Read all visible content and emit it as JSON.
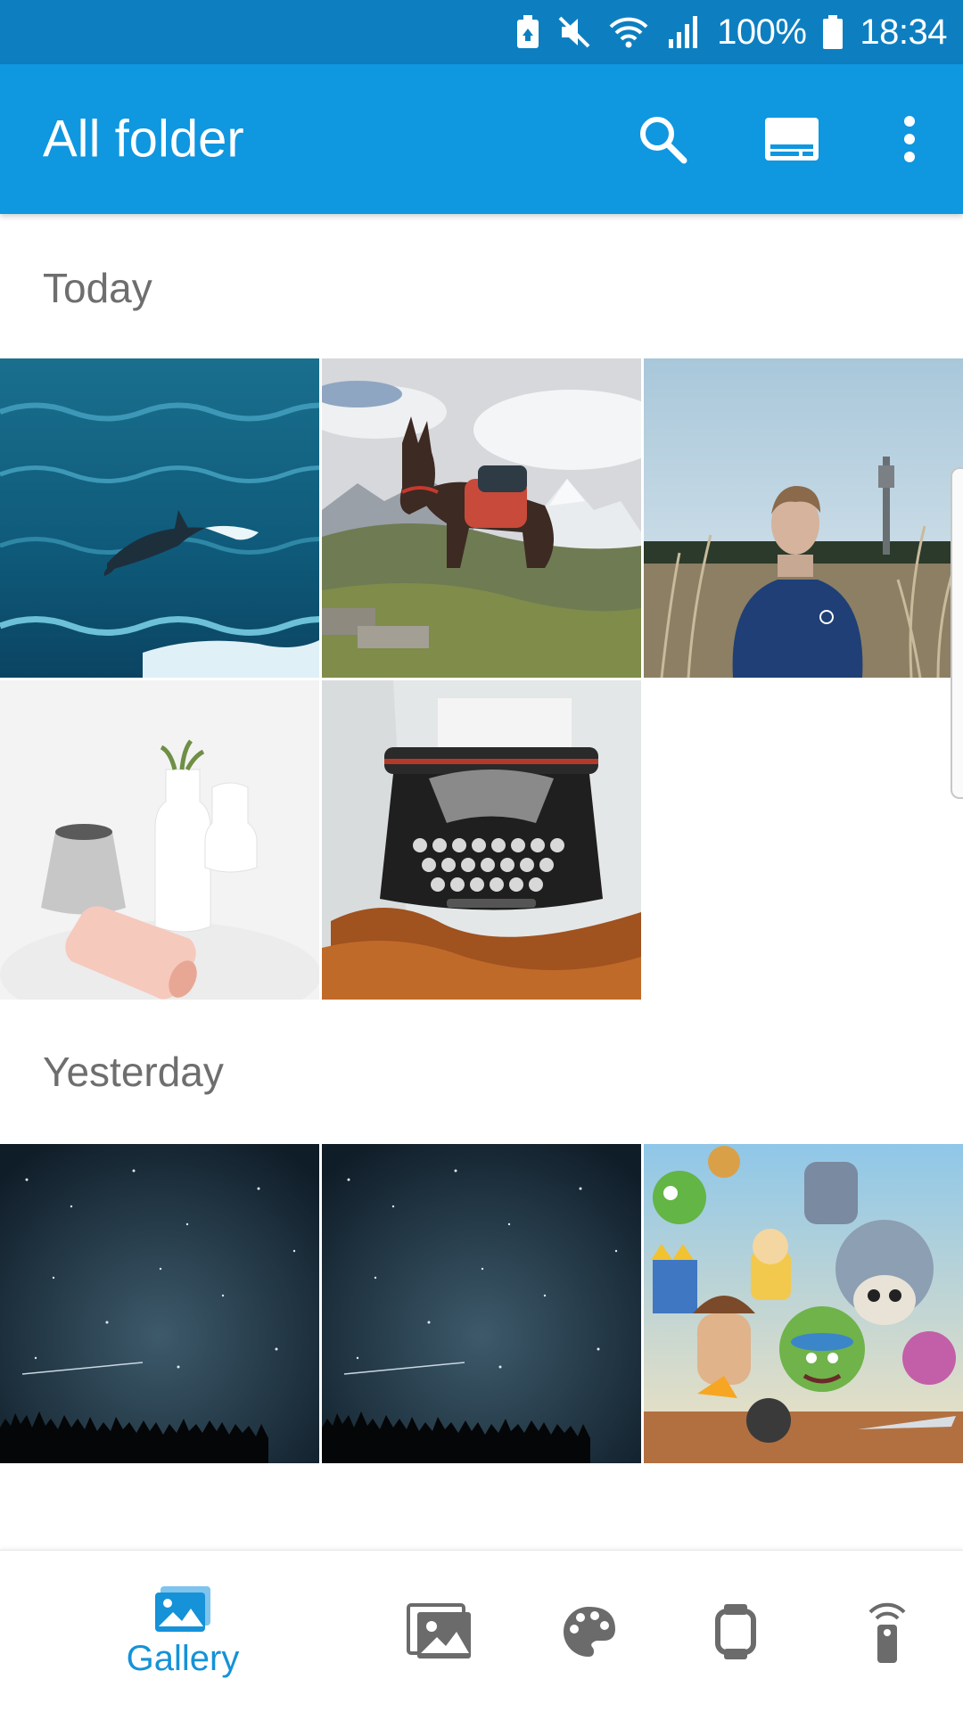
{
  "status_bar": {
    "battery_percent": "100%",
    "time": "18:34",
    "icons": [
      "battery-saver-icon",
      "mute-icon",
      "wifi-icon",
      "signal-icon",
      "battery-icon"
    ]
  },
  "app_bar": {
    "title": "All folder",
    "actions": [
      "search-icon",
      "slideshow-icon",
      "more-vert-icon"
    ]
  },
  "sections": [
    {
      "title": "Today",
      "photos": [
        "dolphin",
        "mule-mountains",
        "man-field-tower",
        "white-vases",
        "typewriter"
      ]
    },
    {
      "title": "Yesterday",
      "photos": [
        "starry-night-1",
        "starry-night-2",
        "clash-royale-art"
      ]
    }
  ],
  "bottom_nav": {
    "items": [
      {
        "icon": "gallery-icon",
        "label": "Gallery",
        "active": true
      },
      {
        "icon": "photos-icon",
        "label": "",
        "active": false
      },
      {
        "icon": "palette-icon",
        "label": "",
        "active": false
      },
      {
        "icon": "watch-icon",
        "label": "",
        "active": false
      },
      {
        "icon": "remote-icon",
        "label": "",
        "active": false
      }
    ]
  },
  "colors": {
    "status_bar": "#0d7fc1",
    "app_bar": "#0f97e0",
    "accent": "#1592d8",
    "section_text": "#6e6e6e",
    "inactive_icon": "#6b6b6b"
  }
}
